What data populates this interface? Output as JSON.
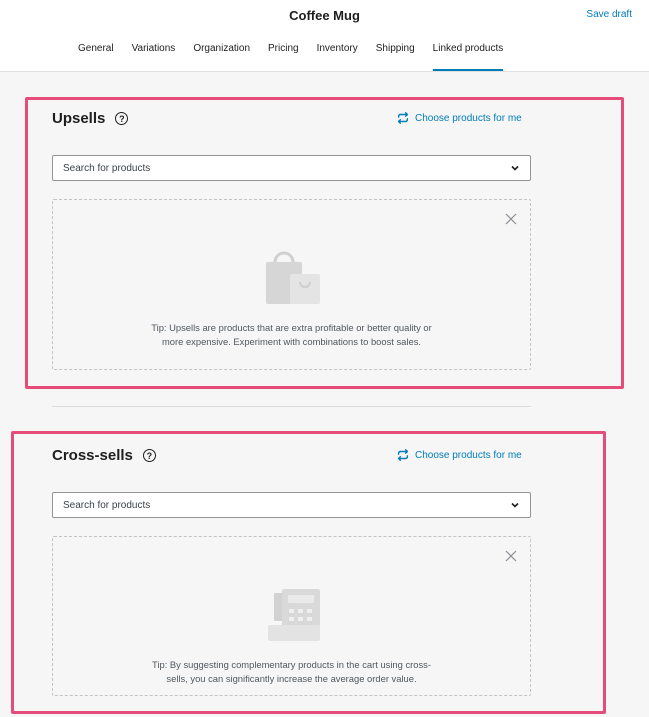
{
  "app": {
    "title": "Coffee Mug",
    "save_draft": "Save draft"
  },
  "tabs": [
    {
      "label": "General",
      "active": false
    },
    {
      "label": "Variations",
      "active": false
    },
    {
      "label": "Organization",
      "active": false
    },
    {
      "label": "Pricing",
      "active": false
    },
    {
      "label": "Inventory",
      "active": false
    },
    {
      "label": "Shipping",
      "active": false
    },
    {
      "label": "Linked products",
      "active": true
    }
  ],
  "upsells": {
    "title": "Upsells",
    "choose": "Choose products for me",
    "search_placeholder": "Search for products",
    "tip_line1": "Tip: Upsells are products that are extra profitable or better quality or",
    "tip_line2": "more expensive. Experiment with combinations to boost sales."
  },
  "crosssells": {
    "title": "Cross-sells",
    "choose": "Choose products for me",
    "search_placeholder": "Search for products",
    "tip_line1": "Tip: By suggesting complementary products in the cart using cross-",
    "tip_line2": "sells, you can significantly increase the average order value."
  },
  "colors": {
    "accent": "#007cba",
    "highlight": "#e64c7a"
  }
}
